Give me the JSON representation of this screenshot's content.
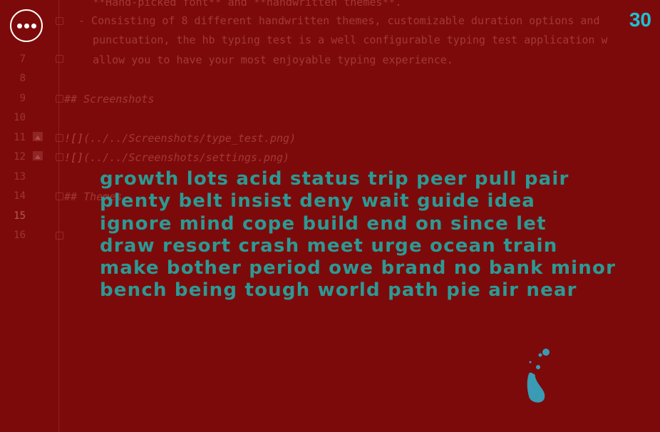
{
  "editor": {
    "line_numbers": [
      "7",
      "8",
      "9",
      "10",
      "11",
      "12",
      "13",
      "14",
      "15",
      "16"
    ],
    "lines": {
      "l4": "**Hand-picked font** and **handwritten themes**.",
      "l5": "- Consisting of 8 different handwritten themes, customizable duration options and",
      "l6": "  punctuation, the hb typing test is a well configurable typing test application w",
      "l7": "  allow you to have your most enjoyable typing experience.",
      "l9": "## Screenshots",
      "l11_bang": "!",
      "l11_alt": "[]",
      "l11_path": "(../../Screenshots/type_test.png)",
      "l12_bang": "!",
      "l12_alt": "[]",
      "l12_path": "(../../Screenshots/settings.png)",
      "l14": "## Themes"
    }
  },
  "menu_button_icon": "more-horizontal-icon",
  "timer": "30",
  "words": [
    "growth lots acid status trip peer pull pair",
    "plenty belt insist deny wait guide idea",
    "ignore mind cope build end on since let",
    "draw resort crash meet urge ocean train",
    "make bother period owe brand no bank minor",
    "bench being tough world path pie air near"
  ],
  "colors": {
    "background": "#7d0a0a",
    "words": "#2b9a95",
    "timer": "#19c3d6"
  }
}
